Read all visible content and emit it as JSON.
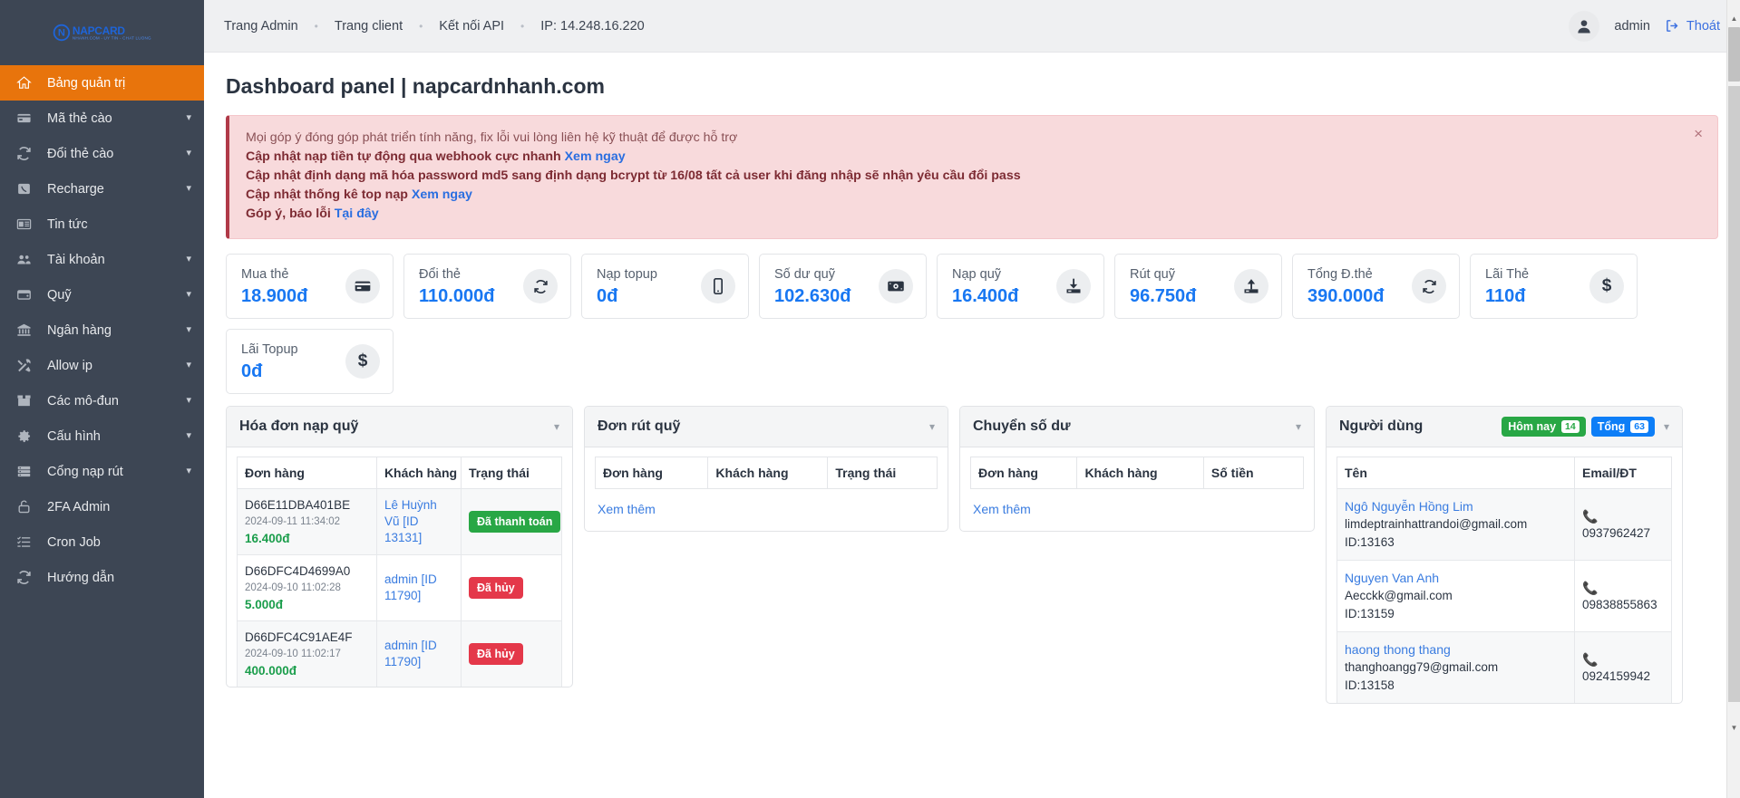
{
  "brand": {
    "logo_mark": "N",
    "logo_main": "NAPCARD",
    "logo_sub": "NHANH.COM - UY TIN - CHAT LUONG"
  },
  "sidebar": {
    "items": [
      {
        "label": "Bảng quản trị",
        "icon": "home-icon",
        "active": true,
        "chevron": false
      },
      {
        "label": "Mã thẻ cào",
        "icon": "card-icon",
        "active": false,
        "chevron": true
      },
      {
        "label": "Đổi thẻ cào",
        "icon": "refresh-icon",
        "active": false,
        "chevron": true
      },
      {
        "label": "Recharge",
        "icon": "phone-icon",
        "active": false,
        "chevron": true
      },
      {
        "label": "Tin tức",
        "icon": "news-icon",
        "active": false,
        "chevron": false
      },
      {
        "label": "Tài khoản",
        "icon": "users-icon",
        "active": false,
        "chevron": true
      },
      {
        "label": "Quỹ",
        "icon": "wallet-icon",
        "active": false,
        "chevron": true
      },
      {
        "label": "Ngân hàng",
        "icon": "bank-icon",
        "active": false,
        "chevron": true
      },
      {
        "label": "Allow ip",
        "icon": "tools-icon",
        "active": false,
        "chevron": true
      },
      {
        "label": "Các mô-đun",
        "icon": "box-icon",
        "active": false,
        "chevron": true
      },
      {
        "label": "Cấu hình",
        "icon": "gear-icon",
        "active": false,
        "chevron": true
      },
      {
        "label": "Cổng nạp rút",
        "icon": "server-icon",
        "active": false,
        "chevron": true
      },
      {
        "label": "2FA Admin",
        "icon": "lock-icon",
        "active": false,
        "chevron": false
      },
      {
        "label": "Cron Job",
        "icon": "checklist-icon",
        "active": false,
        "chevron": false
      },
      {
        "label": "Hướng dẫn",
        "icon": "refresh-icon",
        "active": false,
        "chevron": false
      }
    ]
  },
  "topbar": {
    "breadcrumbs": [
      {
        "label": "Trang Admin",
        "link": true
      },
      {
        "label": "Trang client",
        "link": true
      },
      {
        "label": "Kết nối API",
        "link": true
      },
      {
        "label": "IP: 14.248.16.220",
        "link": false
      }
    ],
    "separator": "•",
    "user": "admin",
    "logout": "Thoát"
  },
  "page": {
    "title": "Dashboard panel | napcardnhanh.com"
  },
  "alert": {
    "close": "×",
    "lines": [
      {
        "text": "Mọi góp ý đóng góp phát triển tính năng, fix lỗi vui lòng liên hệ kỹ thuật để được hỗ trợ",
        "bold": false,
        "link": ""
      },
      {
        "text": "Cập nhật nạp tiền tự động qua webhook cực nhanh ",
        "bold": true,
        "link": "Xem ngay"
      },
      {
        "text": "Cập nhật định dạng mã hóa password md5 sang định dạng bcrypt từ 16/08 tất cả user khi đăng nhập sẽ nhận yêu cầu đổi pass",
        "bold": true,
        "link": ""
      },
      {
        "text": "Cập nhật thống kê top nạp ",
        "bold": true,
        "link": "Xem ngay"
      },
      {
        "text": "Góp ý, báo lỗi ",
        "bold": true,
        "link": "Tại đây"
      }
    ]
  },
  "cards": [
    {
      "label": "Mua thẻ",
      "value": "18.900đ",
      "icon": "credit-card-icon"
    },
    {
      "label": "Đổi thẻ",
      "value": "110.000đ",
      "icon": "refresh-icon"
    },
    {
      "label": "Nạp topup",
      "value": "0đ",
      "icon": "mobile-icon"
    },
    {
      "label": "Số dư quỹ",
      "value": "102.630đ",
      "icon": "money-icon"
    },
    {
      "label": "Nạp quỹ",
      "value": "16.400đ",
      "icon": "download-icon"
    },
    {
      "label": "Rút quỹ",
      "value": "96.750đ",
      "icon": "upload-icon"
    },
    {
      "label": "Tổng Đ.thẻ",
      "value": "390.000đ",
      "icon": "refresh-icon"
    },
    {
      "label": "Lãi Thẻ",
      "value": "110đ",
      "icon": "dollar-icon"
    },
    {
      "label": "Lãi Topup",
      "value": "0đ",
      "icon": "dollar-icon"
    }
  ],
  "panels": {
    "invoices": {
      "title": "Hóa đơn nạp quỹ",
      "columns": [
        "Đơn hàng",
        "Khách hàng",
        "Trạng thái"
      ],
      "rows": [
        {
          "code": "D66E11DBA401BE",
          "date": "2024-09-11 11:34:02",
          "amount": "16.400đ",
          "customer": "Lê Huỳnh Vũ [ID 13131]",
          "status": "Đã thanh toán",
          "status_kind": "paid"
        },
        {
          "code": "D66DFC4D4699A0",
          "date": "2024-09-10 11:02:28",
          "amount": "5.000đ",
          "customer": "admin [ID 11790]",
          "status": "Đã hủy",
          "status_kind": "cancel"
        },
        {
          "code": "D66DFC4C91AE4F",
          "date": "2024-09-10 11:02:17",
          "amount": "400.000đ",
          "customer": "admin [ID 11790]",
          "status": "Đã hủy",
          "status_kind": "cancel"
        }
      ]
    },
    "withdrawals": {
      "title": "Đơn rút quỹ",
      "columns": [
        "Đơn hàng",
        "Khách hàng",
        "Trạng thái"
      ],
      "rows": [],
      "more": "Xem thêm"
    },
    "transfers": {
      "title": "Chuyển số dư",
      "columns": [
        "Đơn hàng",
        "Khách hàng",
        "Số tiền"
      ],
      "rows": [],
      "more": "Xem thêm"
    },
    "users": {
      "title": "Người dùng",
      "badge_today_label": "Hôm nay",
      "badge_today_count": "14",
      "badge_total_label": "Tổng",
      "badge_total_count": "63",
      "columns": [
        "Tên",
        "Email/ĐT"
      ],
      "rows": [
        {
          "name": "Ngô Nguyễn Hồng Lim",
          "email": "limdeptrainhattrandoi@gmail.com",
          "id": "ID:13163",
          "phone": "0937962427"
        },
        {
          "name": "Nguyen Van Anh",
          "email": "Aecckk@gmail.com",
          "id": "ID:13159",
          "phone": "09838855863"
        },
        {
          "name": "haong thong thang",
          "email": "thanghoangg79@gmail.com",
          "id": "ID:13158",
          "phone": "0924159942"
        }
      ]
    }
  },
  "colors": {
    "sidebar": "#3d4654",
    "active": "#e8740c",
    "accent": "#1877f2",
    "green": "#28a745",
    "red": "#e4384a",
    "alert_bg": "#f8dadc"
  }
}
